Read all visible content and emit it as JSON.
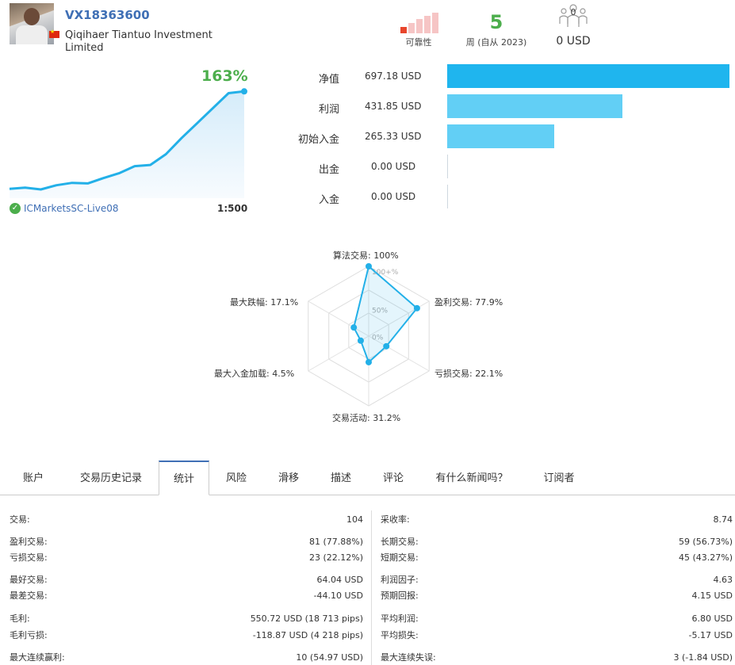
{
  "header": {
    "account_name": "VX18363600",
    "company": "Qiqihaer Tiantuo Investment Limited",
    "reliability_label": "可靠性",
    "weeks_value": "5",
    "weeks_label": "周 (自从 2023)",
    "subscribers_count": "0",
    "subscribers_usd": "0 USD"
  },
  "growth": {
    "percent": "163%",
    "server": "ICMarketsSC-Live08",
    "leverage": "1:500"
  },
  "balance": [
    {
      "label": "净值",
      "value": "697.18 USD",
      "amount": 697.18,
      "color": "#1fb5ee"
    },
    {
      "label": "利润",
      "value": "431.85 USD",
      "amount": 431.85,
      "color": "#62cff5"
    },
    {
      "label": "初始入金",
      "value": "265.33 USD",
      "amount": 265.33,
      "color": "#62cff5"
    },
    {
      "label": "出金",
      "value": "0.00 USD",
      "amount": 0,
      "color": "#62cff5"
    },
    {
      "label": "入金",
      "value": "0.00 USD",
      "amount": 0,
      "color": "#62cff5"
    }
  ],
  "radar": {
    "labels": [
      "算法交易: 100%",
      "盈利交易: 77.9%",
      "亏损交易: 22.1%",
      "交易活动: 31.2%",
      "最大入金加载: 4.5%",
      "最大跌幅: 17.1%"
    ],
    "values": [
      100,
      77.9,
      22.1,
      31.2,
      4.5,
      17.1
    ],
    "ticks": [
      "100+%",
      "50%",
      "0%"
    ]
  },
  "tabs": [
    "账户",
    "交易历史记录",
    "统计",
    "风险",
    "滑移",
    "描述",
    "评论",
    "有什么新闻吗？",
    "订阅者"
  ],
  "stats_left": [
    {
      "label": "交易:",
      "value": "104",
      "style": ""
    },
    {
      "label": "盈利交易:",
      "value": "81 (77.88%)",
      "style": ""
    },
    {
      "label": "亏损交易:",
      "value": "23 (22.12%)",
      "style": ""
    },
    {
      "label": "最好交易:",
      "value": "64.04 USD",
      "style": "blue"
    },
    {
      "label": "最差交易:",
      "value": "-44.10 USD",
      "style": "red"
    },
    {
      "label": "毛利:",
      "value": "550.72 USD (18 713 pips)",
      "style": "blue"
    },
    {
      "label": "毛利亏损:",
      "value": "-118.87 USD (4 218 pips)",
      "style": "red"
    },
    {
      "label": "最大连续赢利:",
      "value": "10 (54.97 USD)",
      "style": ""
    }
  ],
  "stats_right": [
    {
      "label": "采收率:",
      "value": "8.74",
      "style": ""
    },
    {
      "label": "长期交易:",
      "value": "59 (56.73%)",
      "style": ""
    },
    {
      "label": "短期交易:",
      "value": "45 (43.27%)",
      "style": ""
    },
    {
      "label": "利润因子:",
      "value": "4.63",
      "style": ""
    },
    {
      "label": "预期回报:",
      "value": "4.15 USD",
      "style": "blue"
    },
    {
      "label": "平均利润:",
      "value": "6.80 USD",
      "style": "blue"
    },
    {
      "label": "平均损失:",
      "value": "-5.17 USD",
      "style": "red"
    },
    {
      "label": "最大连续失误:",
      "value": "3 (-1.84 USD)",
      "style": ""
    }
  ],
  "chart_data": {
    "type": "area",
    "title": "163%",
    "series": [
      {
        "values": [
          0,
          2,
          -1,
          6,
          10,
          9,
          18,
          26,
          38,
          40,
          58,
          85,
          110,
          135,
          160,
          163
        ]
      }
    ],
    "ylim": [
      -5,
      170
    ],
    "grid": false
  }
}
